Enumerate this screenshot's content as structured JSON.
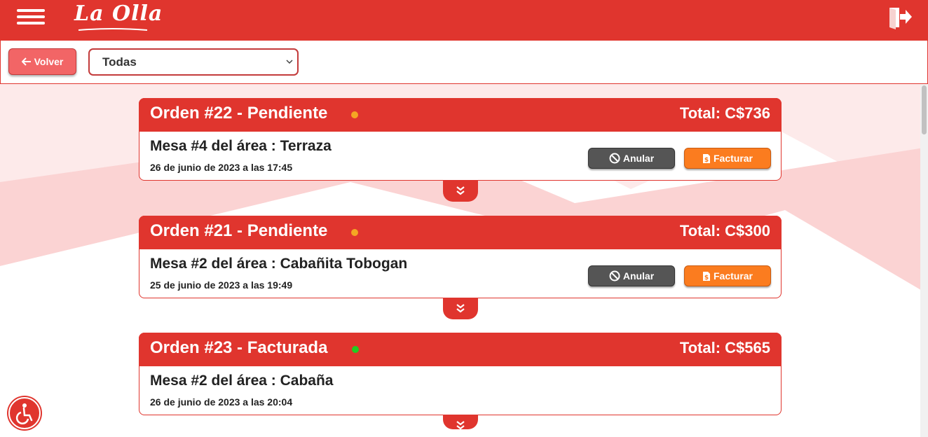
{
  "header": {
    "logo_text": "La Olla",
    "menu_icon": "hamburger-menu-icon",
    "exit_icon": "logout-door-icon"
  },
  "toolbar": {
    "back_label": "Volver",
    "back_icon": "arrow-left-icon",
    "filter_value": "Todas"
  },
  "orders": [
    {
      "title": "Orden #22 - Pendiente",
      "status_color": "#f5a623",
      "total": "Total: C$736",
      "table": "Mesa #4 del área : Terraza",
      "date": "26 de junio de 2023 a las 17:45",
      "cancel_label": "Anular",
      "invoice_label": "Facturar",
      "has_actions": true
    },
    {
      "title": "Orden #21 - Pendiente",
      "status_color": "#f5a623",
      "total": "Total: C$300",
      "table": "Mesa #2 del área : Cabañita Tobogan",
      "date": "25 de junio de 2023 a las 19:49",
      "cancel_label": "Anular",
      "invoice_label": "Facturar",
      "has_actions": true
    },
    {
      "title": "Orden #23 - Facturada",
      "status_color": "#22cc22",
      "total": "Total: C$565",
      "table": "Mesa #2 del área : Cabaña",
      "date": "26 de junio de 2023 a las 20:04",
      "has_actions": false
    }
  ],
  "colors": {
    "primary": "#e0352e",
    "button_dark": "#555555",
    "button_orange": "#fb7c1f",
    "back_button": "#f26566"
  },
  "accessibility_icon": "wheelchair-accessibility-icon"
}
